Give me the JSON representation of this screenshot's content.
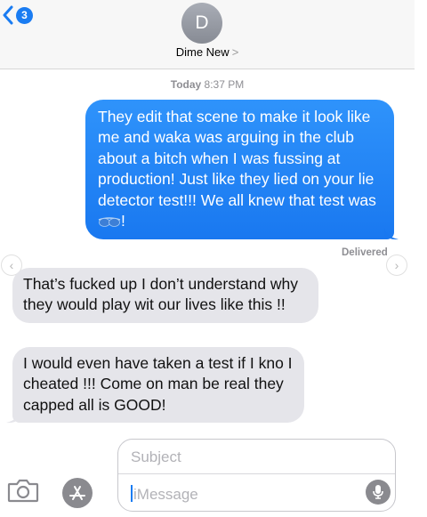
{
  "header": {
    "back_badge": "3",
    "avatar_initial": "D",
    "contact_name": "Dime New",
    "contact_chevron": ">"
  },
  "thread": {
    "timestamp_day": "Today",
    "timestamp_time": "8:37 PM",
    "messages": [
      {
        "direction": "outgoing",
        "text": "They edit that scene to make it look like me and waka was arguing in the club about a bitch when I was fussing at production! Just like they lied on your lie detector test!!! We all knew that test was ",
        "text_end": "!",
        "emoji_icon": "sunglasses-emoji-icon"
      },
      {
        "direction": "incoming",
        "text": "That’s fucked up I don’t understand why they would play wit our lives like this !!"
      },
      {
        "direction": "incoming",
        "text": "I would even have taken a test if I kno I cheated !!! Come on man be real they capped all is GOOD!"
      }
    ],
    "delivered_status": "Delivered"
  },
  "composer": {
    "subject_placeholder": "Subject",
    "message_placeholder": "iMessage"
  },
  "colors": {
    "outgoing_bubble": "#1a7cf2",
    "incoming_bubble": "#e5e5ea",
    "accent": "#1a7cf2"
  },
  "icons": [
    "back-chevron-icon",
    "camera-icon",
    "app-store-icon",
    "microphone-icon",
    "left-arrow-icon",
    "right-arrow-icon",
    "sunglasses-emoji-icon"
  ]
}
